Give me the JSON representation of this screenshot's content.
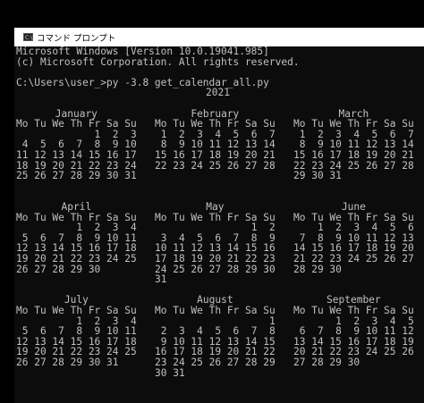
{
  "window": {
    "title": "コマンド プロンプト",
    "icon": "cmd-icon",
    "title_icon_text": "C:\\"
  },
  "console": {
    "header_lines": [
      "Microsoft Windows [Version 10.0.19041.985]",
      "(c) Microsoft Corporation. All rights reserved.",
      "",
      "C:\\Users\\user_>py -3.8 get_calendar_all.py"
    ],
    "year": "2021",
    "rows": [
      {
        "months": [
          {
            "name": "January",
            "lines": [
              "Mo Tu We Th Fr Sa Su",
              "             1  2  3",
              " 4  5  6  7  8  9 10",
              "11 12 13 14 15 16 17",
              "18 19 20 21 22 23 24",
              "25 26 27 28 29 30 31",
              ""
            ]
          },
          {
            "name": "February",
            "lines": [
              "Mo Tu We Th Fr Sa Su",
              " 1  2  3  4  5  6  7",
              " 8  9 10 11 12 13 14",
              "15 16 17 18 19 20 21",
              "22 23 24 25 26 27 28",
              "",
              ""
            ]
          },
          {
            "name": "March",
            "lines": [
              "Mo Tu We Th Fr Sa Su",
              " 1  2  3  4  5  6  7",
              " 8  9 10 11 12 13 14",
              "15 16 17 18 19 20 21",
              "22 23 24 25 26 27 28",
              "29 30 31",
              ""
            ]
          }
        ]
      },
      {
        "months": [
          {
            "name": "April",
            "lines": [
              "Mo Tu We Th Fr Sa Su",
              "          1  2  3  4",
              " 5  6  7  8  9 10 11",
              "12 13 14 15 16 17 18",
              "19 20 21 22 23 24 25",
              "26 27 28 29 30",
              ""
            ]
          },
          {
            "name": "May",
            "lines": [
              "Mo Tu We Th Fr Sa Su",
              "                1  2",
              " 3  4  5  6  7  8  9",
              "10 11 12 13 14 15 16",
              "17 18 19 20 21 22 23",
              "24 25 26 27 28 29 30",
              "31"
            ]
          },
          {
            "name": "June",
            "lines": [
              "Mo Tu We Th Fr Sa Su",
              "    1  2  3  4  5  6",
              " 7  8  9 10 11 12 13",
              "14 15 16 17 18 19 20",
              "21 22 23 24 25 26 27",
              "28 29 30",
              ""
            ]
          }
        ]
      },
      {
        "months": [
          {
            "name": "July",
            "lines": [
              "Mo Tu We Th Fr Sa Su",
              "          1  2  3  4",
              " 5  6  7  8  9 10 11",
              "12 13 14 15 16 17 18",
              "19 20 21 22 23 24 25",
              "26 27 28 29 30 31",
              ""
            ]
          },
          {
            "name": "August",
            "lines": [
              "Mo Tu We Th Fr Sa Su",
              "                   1",
              " 2  3  4  5  6  7  8",
              " 9 10 11 12 13 14 15",
              "16 17 18 19 20 21 22",
              "23 24 25 26 27 28 29",
              "30 31"
            ]
          },
          {
            "name": "September",
            "lines": [
              "Mo Tu We Th Fr Sa Su",
              "       1  2  3  4  5",
              " 6  7  8  9 10 11 12",
              "13 14 15 16 17 18 19",
              "20 21 22 23 24 25 26",
              "27 28 29 30",
              ""
            ]
          }
        ]
      }
    ]
  },
  "colors": {
    "console_bg": "#0c0c0c",
    "console_text": "#c0c0c0",
    "titlebar_bg": "#ffffff"
  }
}
